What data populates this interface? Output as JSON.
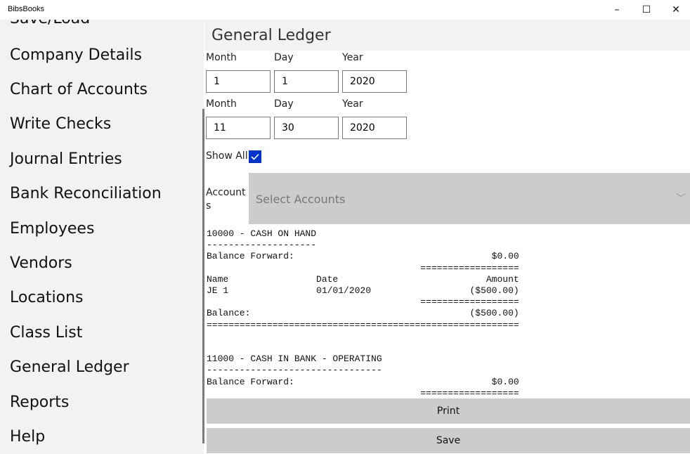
{
  "app": {
    "title": "BibsBooks"
  },
  "window_controls": {
    "minimize": "–",
    "maximize": "☐",
    "close": "✕"
  },
  "sidebar": {
    "items": [
      {
        "label": "Save/Load"
      },
      {
        "label": "Company Details"
      },
      {
        "label": "Chart of Accounts"
      },
      {
        "label": "Write Checks"
      },
      {
        "label": "Journal Entries"
      },
      {
        "label": "Bank Reconciliation"
      },
      {
        "label": "Employees"
      },
      {
        "label": "Vendors"
      },
      {
        "label": "Locations"
      },
      {
        "label": "Class List"
      },
      {
        "label": "General Ledger"
      },
      {
        "label": "Reports"
      },
      {
        "label": "Help"
      }
    ]
  },
  "page": {
    "title": "General Ledger"
  },
  "start_date": {
    "month_label": "Month",
    "day_label": "Day",
    "year_label": "Year",
    "month": "1",
    "day": "1",
    "year": "2020"
  },
  "end_date": {
    "month_label": "Month",
    "day_label": "Day",
    "year_label": "Year",
    "month": "11",
    "day": "30",
    "year": "2020"
  },
  "show_all": {
    "label": "Show All",
    "checked": true
  },
  "accounts": {
    "label": "Accounts",
    "placeholder": "Select Accounts"
  },
  "report": {
    "text": "10000 - CASH ON HAND\n--------------------\nBalance Forward:                                    $0.00\n                                       ==================\nName                Date                           Amount\nJE 1                01/01/2020                  ($500.00)\n                                       ==================\nBalance:                                        ($500.00)\n=========================================================\n\n\n11000 - CASH IN BANK - OPERATING\n--------------------------------\nBalance Forward:                                    $0.00\n                                       =================="
  },
  "actions": {
    "print_label": "Print",
    "save_label": "Save"
  },
  "colors": {
    "checkbox": "#0033cc",
    "button_bg": "#cccccc",
    "sidebar_bg": "#f2f2f2"
  }
}
